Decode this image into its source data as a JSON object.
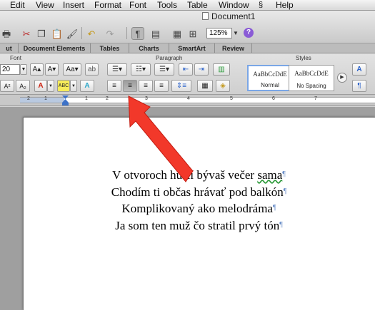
{
  "menubar": {
    "items": [
      "Edit",
      "View",
      "Insert",
      "Format",
      "Font",
      "Tools",
      "Table",
      "Window",
      "Help"
    ],
    "script_icon": "script-icon"
  },
  "window": {
    "title": "Document1"
  },
  "toolbar": {
    "zoom": "125%"
  },
  "ribbon_tabs": [
    "ut",
    "Document Elements",
    "Tables",
    "Charts",
    "SmartArt",
    "Review"
  ],
  "ribbon": {
    "font_group_label": "Font",
    "paragraph_group_label": "Paragraph",
    "styles_group_label": "Styles",
    "font_size": "20",
    "styles": [
      {
        "sample": "AaBbCcDdE",
        "name": "Normal",
        "selected": true
      },
      {
        "sample": "AaBbCcDdE",
        "name": "No Spacing",
        "selected": false
      }
    ]
  },
  "ruler": {
    "numbers": [
      "2",
      "1",
      "1",
      "2",
      "3",
      "4",
      "5",
      "6",
      "7"
    ]
  },
  "document": {
    "lines": [
      {
        "text": "V otvoroch huslí bývaš večer ",
        "squiggle": "sama"
      },
      {
        "text": "Chodím ti občas hrávať pod balkón",
        "squiggle": ""
      },
      {
        "text": "Komplikovaný ako melodráma",
        "squiggle": ""
      },
      {
        "text": "Ja som ten muž čo stratil prvý tón",
        "squiggle": ""
      }
    ],
    "pilcrow": "¶",
    "alignment": "center"
  },
  "colors": {
    "annotation_arrow": "#f2382a",
    "pilcrow": "#6b8fc9",
    "help_button": "#8a5bd6"
  }
}
